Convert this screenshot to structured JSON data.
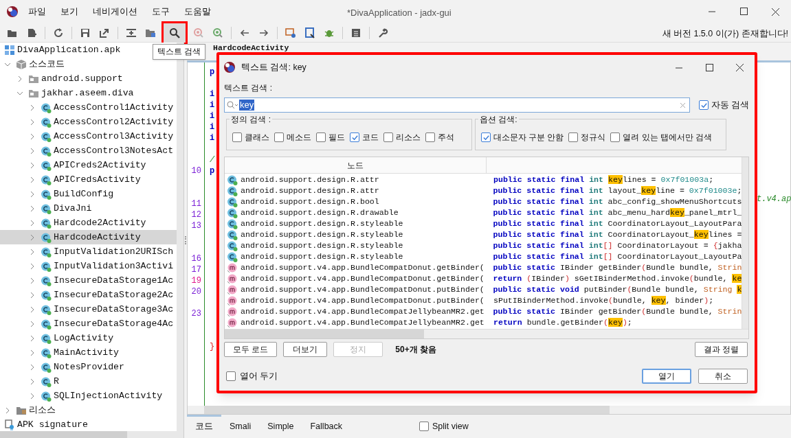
{
  "window": {
    "title": "*DivaApplication - jadx-gui"
  },
  "menu": [
    "파일",
    "보기",
    "네비게이션",
    "도구",
    "도움말"
  ],
  "toolbar": {
    "notice": "새 버전 1.5.0 이(가) 존재합니다!"
  },
  "tooltip": "텍스트 검색",
  "tree": [
    {
      "label": "DivaApplication.apk",
      "kind": "apk",
      "selected": false
    },
    {
      "label": "소스코드",
      "kind": "source",
      "expanded": true,
      "selected": false,
      "children": [
        {
          "label": "android.support",
          "kind": "folder",
          "expanded": false,
          "selected": false
        },
        {
          "label": "jakhar.aseem.diva",
          "kind": "folder",
          "expanded": true,
          "selected": false,
          "children": [
            {
              "label": "AccessControl1Activity",
              "kind": "class",
              "expanded": false,
              "selected": false
            },
            {
              "label": "AccessControl2Activity",
              "kind": "class",
              "expanded": false,
              "selected": false
            },
            {
              "label": "AccessControl3Activity",
              "kind": "class",
              "expanded": false,
              "selected": false
            },
            {
              "label": "AccessControl3NotesAct",
              "kind": "class",
              "expanded": false,
              "selected": false
            },
            {
              "label": "APICreds2Activity",
              "kind": "class",
              "expanded": false,
              "selected": false
            },
            {
              "label": "APICredsActivity",
              "kind": "class",
              "expanded": false,
              "selected": false
            },
            {
              "label": "BuildConfig",
              "kind": "class",
              "expanded": false,
              "selected": false
            },
            {
              "label": "DivaJni",
              "kind": "class",
              "expanded": false,
              "selected": false
            },
            {
              "label": "Hardcode2Activity",
              "kind": "class",
              "expanded": false,
              "selected": false
            },
            {
              "label": "HardcodeActivity",
              "kind": "class",
              "expanded": false,
              "selected": true
            },
            {
              "label": "InputValidation2URISch",
              "kind": "class",
              "expanded": false,
              "selected": false
            },
            {
              "label": "InputValidation3Activi",
              "kind": "class",
              "expanded": false,
              "selected": false
            },
            {
              "label": "InsecureDataStorage1Ac",
              "kind": "class",
              "expanded": false,
              "selected": false
            },
            {
              "label": "InsecureDataStorage2Ac",
              "kind": "class",
              "expanded": false,
              "selected": false
            },
            {
              "label": "InsecureDataStorage3Ac",
              "kind": "class",
              "expanded": false,
              "selected": false
            },
            {
              "label": "InsecureDataStorage4Ac",
              "kind": "class",
              "expanded": false,
              "selected": false
            },
            {
              "label": "LogActivity",
              "kind": "class",
              "expanded": false,
              "selected": false
            },
            {
              "label": "MainActivity",
              "kind": "class",
              "expanded": false,
              "selected": false
            },
            {
              "label": "NotesProvider",
              "kind": "class",
              "expanded": false,
              "selected": false
            },
            {
              "label": "R",
              "kind": "class",
              "expanded": false,
              "selected": false
            },
            {
              "label": "SQLInjectionActivity",
              "kind": "class",
              "expanded": false,
              "selected": false
            }
          ]
        }
      ]
    },
    {
      "label": "리소스",
      "kind": "resources",
      "expanded": false,
      "selected": false
    },
    {
      "label": "APK signature",
      "kind": "signature",
      "selected": false
    }
  ],
  "editor": {
    "tab": "HardcodeActivity",
    "rows": [
      {
        "code": "p",
        "kind": "kw"
      },
      {},
      {
        "code": "i",
        "kind": "kw"
      },
      {
        "code": "i",
        "kind": "kw"
      },
      {
        "code": "i",
        "kind": "kw"
      },
      {
        "code": "i",
        "kind": "kw"
      },
      {
        "code": "i",
        "kind": "kw"
      },
      {},
      {
        "code": "/",
        "kind": "comment"
      },
      {
        "number": "10",
        "color": "#7a1fd6",
        "code": "p",
        "kind": "kw"
      },
      {},
      {},
      {
        "number": "11",
        "color": "#7a1fd6"
      },
      {
        "number": "12",
        "color": "#7a1fd6"
      },
      {
        "number": "13",
        "color": "#7a1fd6"
      },
      {},
      {},
      {
        "number": "16",
        "color": "#7a1fd6"
      },
      {
        "number": "17",
        "color": "#7a1fd6"
      },
      {
        "number": "19",
        "color": "#e0158a"
      },
      {
        "number": "20",
        "color": "#7a1fd6"
      },
      {},
      {
        "number": "23",
        "color": "#7a1fd6"
      },
      {},
      {},
      {
        "code": "}",
        "kind": "brace"
      }
    ],
    "overflow_fragment": "t.v4.ap"
  },
  "bottom_tabs": [
    {
      "label": "코드",
      "selected": true
    },
    {
      "label": "Smali",
      "selected": false
    },
    {
      "label": "Simple",
      "selected": false
    },
    {
      "label": "Fallback",
      "selected": false
    }
  ],
  "split_view": {
    "label": "Split view",
    "checked": false
  },
  "dialog": {
    "title": "텍스트 검색: key",
    "search_label": "텍스트 검색 :",
    "query": "key",
    "auto_search": {
      "label": "자동 검색",
      "checked": true
    },
    "groups": [
      {
        "title": "정의 검색 :",
        "options": [
          {
            "label": "클래스",
            "checked": false
          },
          {
            "label": "메소드",
            "checked": false
          },
          {
            "label": "필드",
            "checked": false
          },
          {
            "label": "코드",
            "checked": true
          },
          {
            "label": "리소스",
            "checked": false
          },
          {
            "label": "주석",
            "checked": false
          }
        ]
      },
      {
        "title": "옵션 검색:",
        "options": [
          {
            "label": "대소문자 구분 안함",
            "checked": true
          },
          {
            "label": "정규식",
            "checked": false
          },
          {
            "label": "열려 있는 탭에서만 검색",
            "checked": false
          }
        ]
      }
    ],
    "columns": [
      "노드"
    ],
    "results": [
      {
        "kind": "class",
        "node": "android.support.design.R.attr",
        "code": [
          {
            "kind": "kw",
            "text": "public static final"
          },
          {
            "kind": "type",
            "text": " int "
          },
          {
            "kind": "match",
            "text": "key"
          },
          {
            "kind": "plain",
            "text": "lines = "
          },
          {
            "kind": "num",
            "text": "0x7f01003a"
          },
          {
            "kind": "plain",
            "text": ";"
          }
        ]
      },
      {
        "kind": "class",
        "node": "android.support.design.R.attr",
        "code": [
          {
            "kind": "kw",
            "text": "public static final"
          },
          {
            "kind": "type",
            "text": " int"
          },
          {
            "kind": "plain",
            "text": " layout_"
          },
          {
            "kind": "match",
            "text": "key"
          },
          {
            "kind": "plain",
            "text": "line = "
          },
          {
            "kind": "num",
            "text": "0x7f01003e"
          },
          {
            "kind": "plain",
            "text": ";"
          }
        ]
      },
      {
        "kind": "class",
        "node": "android.support.design.R.bool",
        "code": [
          {
            "kind": "kw",
            "text": "public static final"
          },
          {
            "kind": "type",
            "text": " int"
          },
          {
            "kind": "plain",
            "text": " abc_config_showMenuShortcuts"
          }
        ]
      },
      {
        "kind": "class",
        "node": "android.support.design.R.drawable",
        "code": [
          {
            "kind": "kw",
            "text": "public static final"
          },
          {
            "kind": "type",
            "text": " int"
          },
          {
            "kind": "plain",
            "text": " abc_menu_hard"
          },
          {
            "kind": "match",
            "text": "key"
          },
          {
            "kind": "plain",
            "text": "_panel_mtrl_"
          }
        ]
      },
      {
        "kind": "class",
        "node": "android.support.design.R.styleable",
        "code": [
          {
            "kind": "kw",
            "text": "public static final"
          },
          {
            "kind": "type",
            "text": " int"
          },
          {
            "kind": "plain",
            "text": " CoordinatorLayout_LayoutPara"
          }
        ]
      },
      {
        "kind": "class",
        "node": "android.support.design.R.styleable",
        "code": [
          {
            "kind": "kw",
            "text": "public static final"
          },
          {
            "kind": "type",
            "text": " int"
          },
          {
            "kind": "plain",
            "text": " CoordinatorLayout_"
          },
          {
            "kind": "match",
            "text": "key"
          },
          {
            "kind": "plain",
            "text": "lines ="
          }
        ]
      },
      {
        "kind": "class",
        "node": "android.support.design.R.styleable",
        "code": [
          {
            "kind": "kw",
            "text": "public static final"
          },
          {
            "kind": "type",
            "text": " int"
          },
          {
            "kind": "punct",
            "text": "[]"
          },
          {
            "kind": "plain",
            "text": " CoordinatorLayout = "
          },
          {
            "kind": "punct",
            "text": "{"
          },
          {
            "kind": "plain",
            "text": "jakha"
          }
        ]
      },
      {
        "kind": "class",
        "node": "android.support.design.R.styleable",
        "code": [
          {
            "kind": "kw",
            "text": "public static final"
          },
          {
            "kind": "type",
            "text": " int"
          },
          {
            "kind": "punct",
            "text": "[]"
          },
          {
            "kind": "plain",
            "text": " CoordinatorLayout_LayoutPa"
          }
        ]
      },
      {
        "kind": "method",
        "node": "android.support.v4.app.BundleCompatDonut.getBinder(",
        "code": [
          {
            "kind": "kw",
            "text": "public static"
          },
          {
            "kind": "plain",
            "text": " IBinder getBinder"
          },
          {
            "kind": "punct",
            "text": "("
          },
          {
            "kind": "plain",
            "text": "Bundle bundle, "
          },
          {
            "kind": "str",
            "text": "Strin"
          }
        ]
      },
      {
        "kind": "method",
        "node": "android.support.v4.app.BundleCompatDonut.getBinder(",
        "code": [
          {
            "kind": "kw",
            "text": "return "
          },
          {
            "kind": "punct",
            "text": "("
          },
          {
            "kind": "plain",
            "text": "IBinder"
          },
          {
            "kind": "punct",
            "text": ")"
          },
          {
            "kind": "plain",
            "text": " sGetIBinderMethod.invoke"
          },
          {
            "kind": "punct",
            "text": "("
          },
          {
            "kind": "plain",
            "text": "bundle, "
          },
          {
            "kind": "match",
            "text": "ke"
          }
        ]
      },
      {
        "kind": "method",
        "node": "android.support.v4.app.BundleCompatDonut.putBinder(",
        "code": [
          {
            "kind": "kw",
            "text": "public static void"
          },
          {
            "kind": "plain",
            "text": " putBinder"
          },
          {
            "kind": "punct",
            "text": "("
          },
          {
            "kind": "plain",
            "text": "Bundle bundle, "
          },
          {
            "kind": "str",
            "text": "String "
          },
          {
            "kind": "match",
            "text": "k"
          }
        ]
      },
      {
        "kind": "method",
        "node": "android.support.v4.app.BundleCompatDonut.putBinder(",
        "code": [
          {
            "kind": "plain",
            "text": "sPutIBinderMethod.invoke"
          },
          {
            "kind": "punct",
            "text": "("
          },
          {
            "kind": "plain",
            "text": "bundle, "
          },
          {
            "kind": "match",
            "text": "key"
          },
          {
            "kind": "plain",
            "text": ", binder"
          },
          {
            "kind": "punct",
            "text": ")"
          },
          {
            "kind": "plain",
            "text": ";"
          }
        ]
      },
      {
        "kind": "method",
        "node": "android.support.v4.app.BundleCompatJellybeanMR2.get",
        "code": [
          {
            "kind": "kw",
            "text": "public static"
          },
          {
            "kind": "plain",
            "text": " IBinder getBinder"
          },
          {
            "kind": "punct",
            "text": "("
          },
          {
            "kind": "plain",
            "text": "Bundle bundle, "
          },
          {
            "kind": "str",
            "text": "Strin"
          }
        ]
      },
      {
        "kind": "method",
        "node": "android.support.v4.app.BundleCompatJellybeanMR2.get",
        "code": [
          {
            "kind": "kw",
            "text": "return"
          },
          {
            "kind": "plain",
            "text": " bundle.getBinder"
          },
          {
            "kind": "punct",
            "text": "("
          },
          {
            "kind": "match",
            "text": "key"
          },
          {
            "kind": "punct",
            "text": ")"
          },
          {
            "kind": "plain",
            "text": ";"
          }
        ]
      }
    ],
    "buttons": [
      {
        "label": "모두 로드",
        "disabled": false
      },
      {
        "label": "더보기",
        "disabled": false
      },
      {
        "label": "정지",
        "disabled": true
      }
    ],
    "status": "50+개 찾음",
    "sort_button": "결과 정렬",
    "keep_open": {
      "label": "열어 두기",
      "checked": false
    },
    "open_button": "열기",
    "cancel_button": "취소"
  }
}
